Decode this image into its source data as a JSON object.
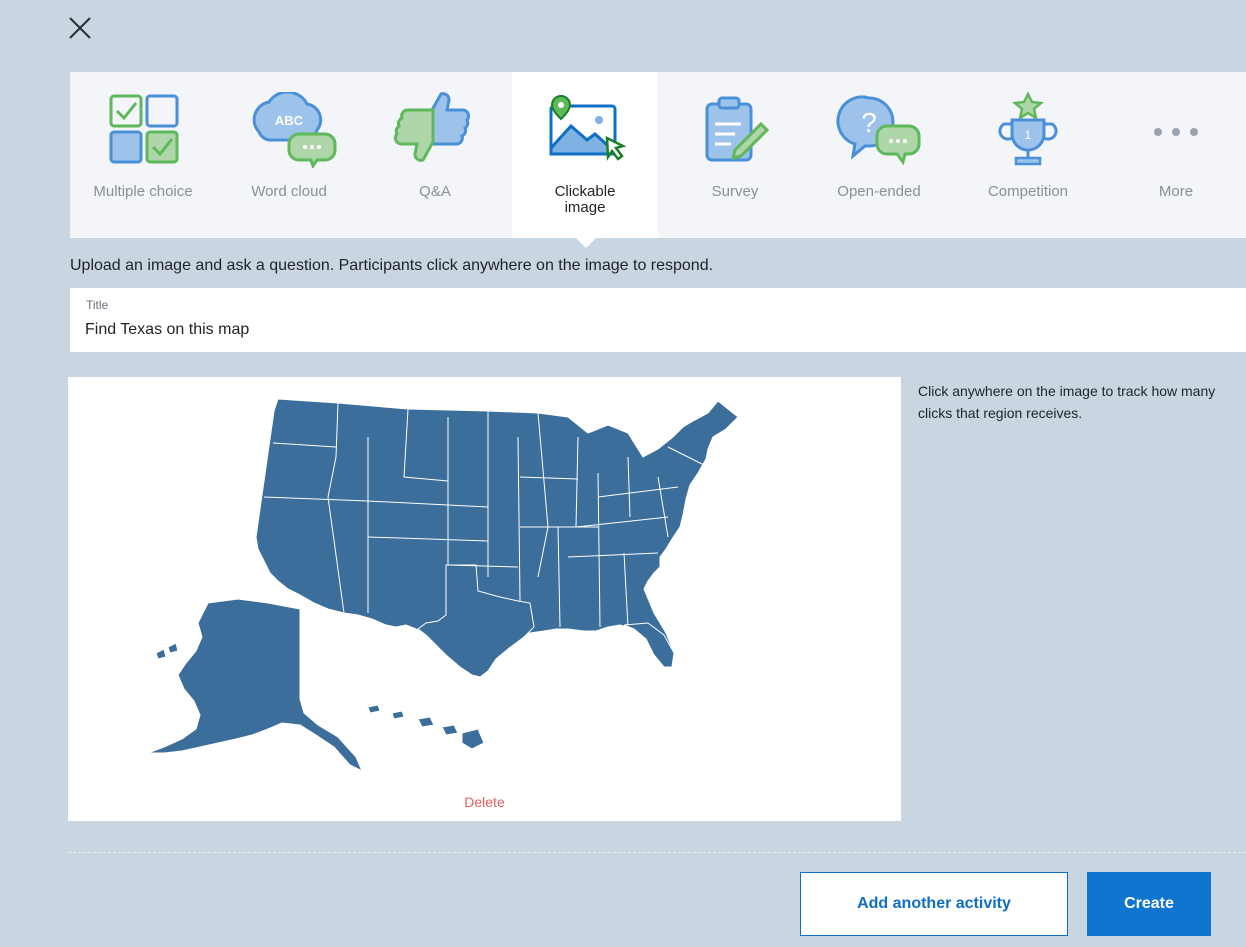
{
  "activity_types": [
    {
      "label": "Multiple choice",
      "icon": "multiple-choice-icon",
      "active": false
    },
    {
      "label": "Word cloud",
      "icon": "word-cloud-icon",
      "icon_text": "ABC",
      "active": false
    },
    {
      "label": "Q&A",
      "icon": "thumbs-icon",
      "active": false
    },
    {
      "label": "Clickable image",
      "icon": "clickable-image-icon",
      "active": true
    },
    {
      "label": "Survey",
      "icon": "survey-icon",
      "active": false
    },
    {
      "label": "Open-ended",
      "icon": "open-ended-icon",
      "active": false
    },
    {
      "label": "Competition",
      "icon": "trophy-icon",
      "icon_text": "1",
      "active": false
    },
    {
      "label": "More",
      "icon": "more-dots-icon",
      "active": false
    }
  ],
  "description": "Upload an image and ask a question. Participants click anywhere on the image to respond.",
  "title_field": {
    "label": "Title",
    "value": "Find Texas on this map"
  },
  "image_card": {
    "delete_label": "Delete",
    "image": "us-map-image"
  },
  "hint": "Click anywhere on the image to track how many clicks that region receives.",
  "footer": {
    "add_another_label": "Add another activity",
    "create_label": "Create"
  },
  "colors": {
    "accent": "#0f75cf",
    "map": "#3b6e9a",
    "green": "#5fb85a",
    "blue": "#4a90d9",
    "delete": "#e35d5b"
  }
}
